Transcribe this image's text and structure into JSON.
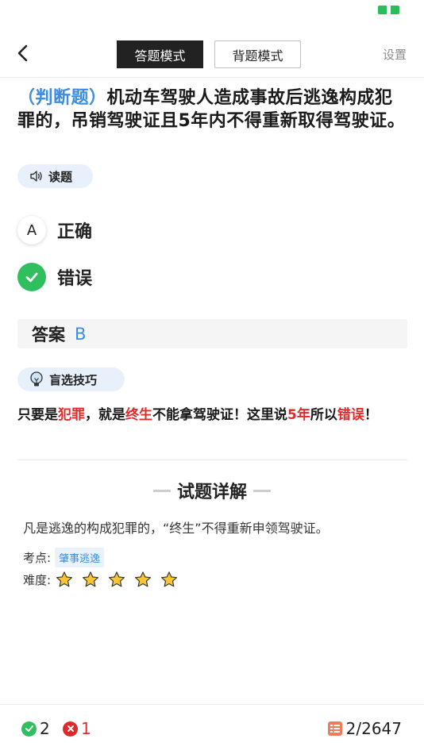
{
  "nav": {
    "tabs": [
      "答题模式",
      "背题模式"
    ],
    "active_tab": "答题模式",
    "settings_label": "设置"
  },
  "question": {
    "type_label": "（判断题）",
    "text": "机动车驾驶人造成事故后逃逸构成犯罪的，吊销驾驶证且5年内不得重新取得驾驶证。",
    "read_label": "读题"
  },
  "options": [
    {
      "key": "A",
      "text": "正确",
      "state": "normal"
    },
    {
      "key": "B",
      "text": "错误",
      "state": "correct-selected"
    }
  ],
  "answer": {
    "label": "答案",
    "value": "B"
  },
  "tips": {
    "label": "盲选技巧",
    "segments": [
      {
        "text": "只要是",
        "highlight": false
      },
      {
        "text": "犯罪",
        "highlight": true
      },
      {
        "text": "，就是",
        "highlight": false
      },
      {
        "text": "终生",
        "highlight": true
      },
      {
        "text": "不能拿驾驶证！这里说",
        "highlight": false
      },
      {
        "text": "5年",
        "highlight": true
      },
      {
        "text": "所以",
        "highlight": false
      },
      {
        "text": "错误",
        "highlight": true
      },
      {
        "text": "！",
        "highlight": false
      }
    ]
  },
  "detail": {
    "title": "试题详解",
    "explanation": "凡是逃逸的构成犯罪的，“终生”不得重新申领驾驶证。",
    "point_label": "考点:",
    "point_tag": "肇事逃逸",
    "difficulty_label": "难度:",
    "difficulty_stars": 5
  },
  "footer": {
    "correct_count": "2",
    "wrong_count": "1",
    "progress": "2/2647"
  },
  "colors": {
    "accent_blue": "#3d8ce0",
    "correct_green": "#2fbf5e",
    "wrong_red": "#e02a2a",
    "star_yellow": "#f7c531",
    "progress_orange": "#f07c5c"
  },
  "icons": {
    "back": "chevron-left-icon",
    "read": "speaker-icon",
    "tips": "lightbulb-icon",
    "check": "check-icon",
    "correct": "check-circle-icon",
    "wrong": "x-circle-icon",
    "progress": "list-icon",
    "star": "star-icon"
  }
}
